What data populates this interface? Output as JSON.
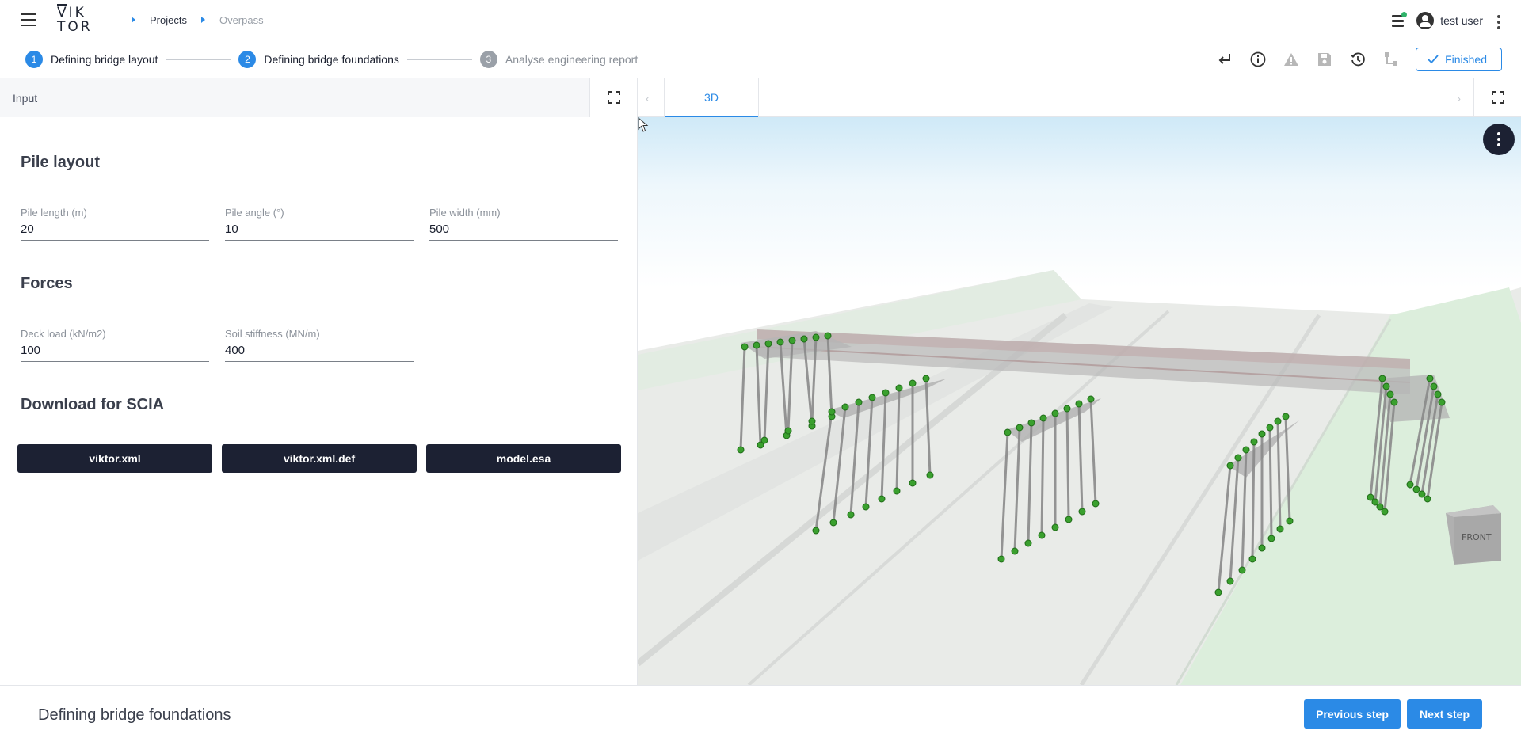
{
  "app": {
    "logo_line1": "VIK",
    "logo_line2": "TOR"
  },
  "breadcrumbs": {
    "projects": "Projects",
    "current": "Overpass"
  },
  "user": {
    "name": "test user"
  },
  "steps": [
    {
      "number": "1",
      "label": "Defining bridge layout"
    },
    {
      "number": "2",
      "label": "Defining bridge foundations"
    },
    {
      "number": "3",
      "label": "Analyse engineering report"
    }
  ],
  "toolbar": {
    "finished_label": "Finished"
  },
  "input_panel": {
    "title": "Input",
    "pile_layout": {
      "heading": "Pile layout",
      "pile_length": {
        "label": "Pile length (m)",
        "value": "20"
      },
      "pile_angle": {
        "label": "Pile angle (°)",
        "value": "10"
      },
      "pile_width": {
        "label": "Pile width (mm)",
        "value": "500"
      }
    },
    "forces": {
      "heading": "Forces",
      "deck_load": {
        "label": "Deck load (kN/m2)",
        "value": "100"
      },
      "soil_stiffness": {
        "label": "Soil stiffness (MN/m)",
        "value": "400"
      }
    },
    "download": {
      "heading": "Download for SCIA",
      "buttons": [
        "viktor.xml",
        "viktor.xml.def",
        "model.esa"
      ]
    }
  },
  "view": {
    "tab_label": "3D",
    "cube_label": "FRONT"
  },
  "footer": {
    "title": "Defining bridge foundations",
    "previous": "Previous step",
    "next": "Next step"
  }
}
